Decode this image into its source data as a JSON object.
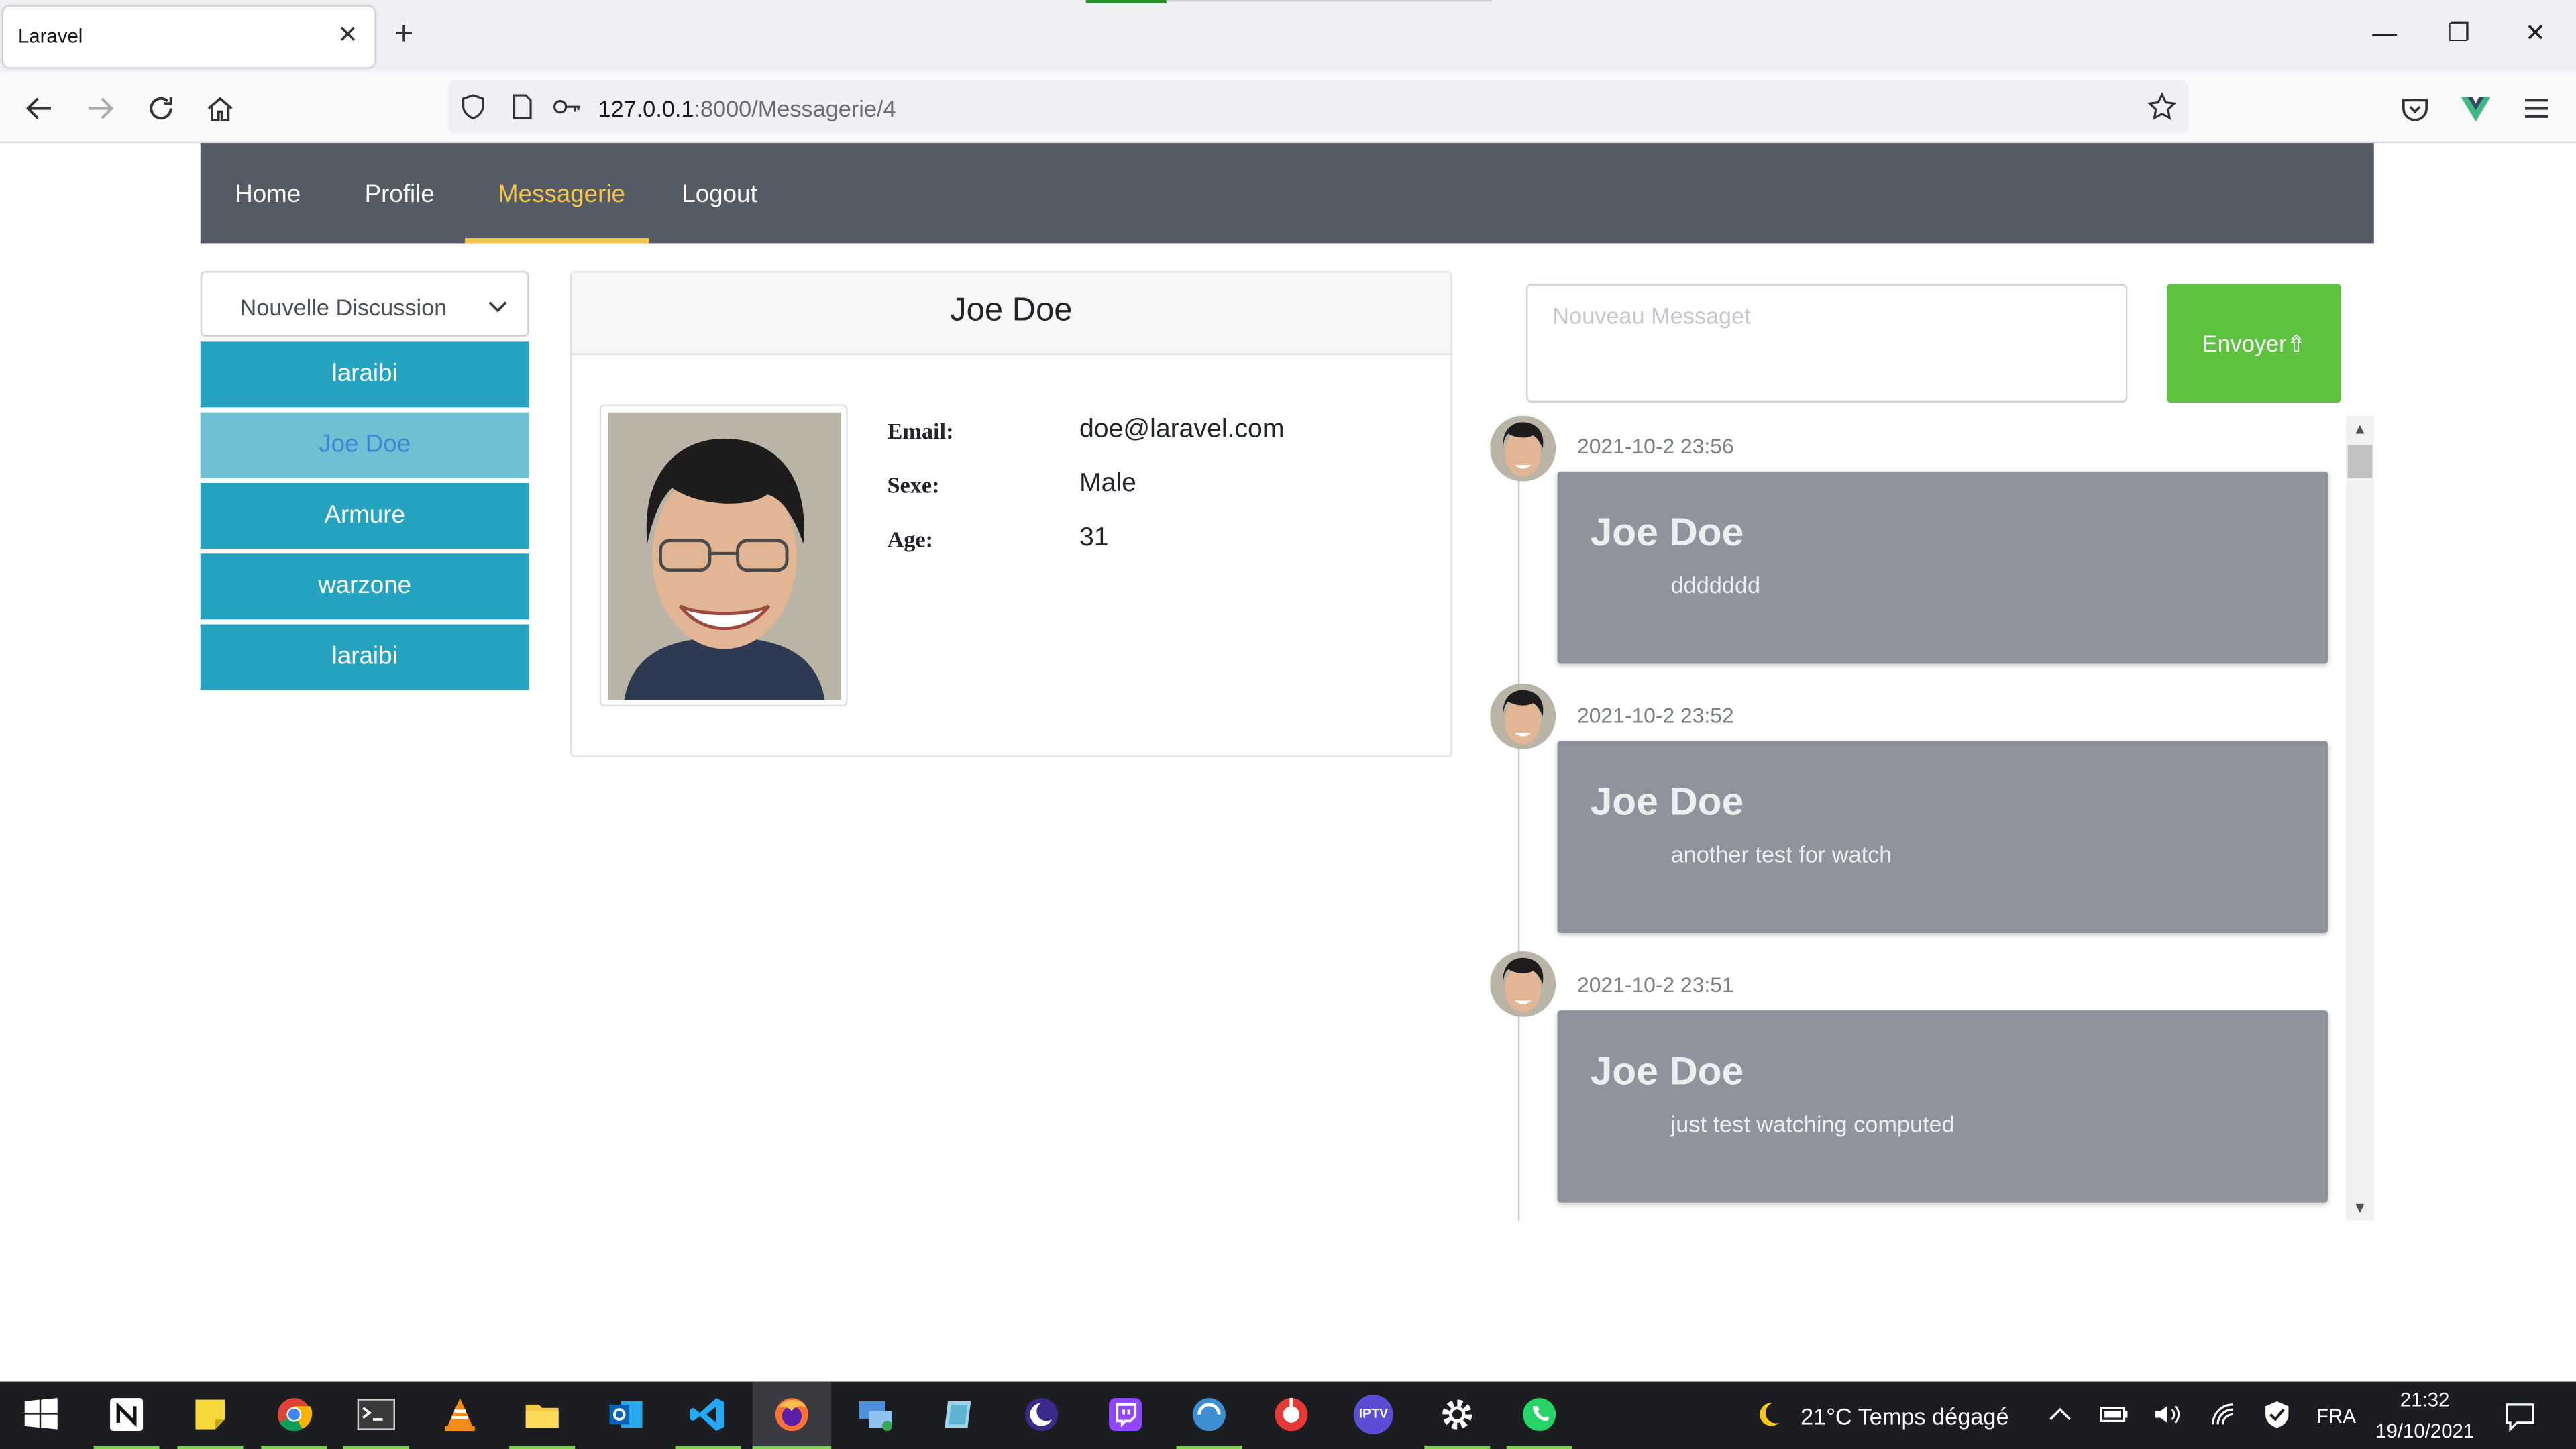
{
  "browser": {
    "tab_title": "Laravel",
    "tab_close": "✕",
    "new_tab": "+",
    "url_host": "127.0.0.1",
    "url_rest": ":8000/Messagerie/4",
    "win_minimize": "—",
    "win_restore": "❐",
    "win_close": "✕"
  },
  "appnav": {
    "items": [
      {
        "label": "Home"
      },
      {
        "label": "Profile"
      },
      {
        "label": "Messagerie"
      },
      {
        "label": "Logout"
      }
    ],
    "active_color": "#f7c548"
  },
  "sidebar": {
    "select_label": "Nouvelle Discussion",
    "contacts": [
      {
        "label": "laraibi"
      },
      {
        "label": "Joe Doe"
      },
      {
        "label": "Armure"
      },
      {
        "label": "warzone"
      },
      {
        "label": "laraibi"
      }
    ]
  },
  "profile": {
    "name": "Joe Doe",
    "email_label": "Email:",
    "email": "doe@laravel.com",
    "sexe_label": "Sexe:",
    "sexe": "Male",
    "age_label": "Age:",
    "age": "31"
  },
  "composer": {
    "placeholder": "Nouveau Messaget",
    "send_label": "Envoyer⇮"
  },
  "messages": [
    {
      "time": "2021-10-2 23:56",
      "name": "Joe Doe",
      "text": "ddddddd"
    },
    {
      "time": "2021-10-2 23:52",
      "name": "Joe Doe",
      "text": "another test for watch"
    },
    {
      "time": "2021-10-2 23:51",
      "name": "Joe Doe",
      "text": "just test watching computed"
    }
  ],
  "taskbar": {
    "weather": "21°C  Temps dégagé",
    "lang": "FRA",
    "time": "21:32",
    "date": "19/10/2021",
    "iptv_label": "IPTV"
  },
  "colors": {
    "navbar_bg": "#545b64",
    "contact_bg": "#24a2c0",
    "contact_active_bg": "#6ec0d3",
    "send_bg": "#5dc240",
    "bubble_bg": "#90939b"
  }
}
